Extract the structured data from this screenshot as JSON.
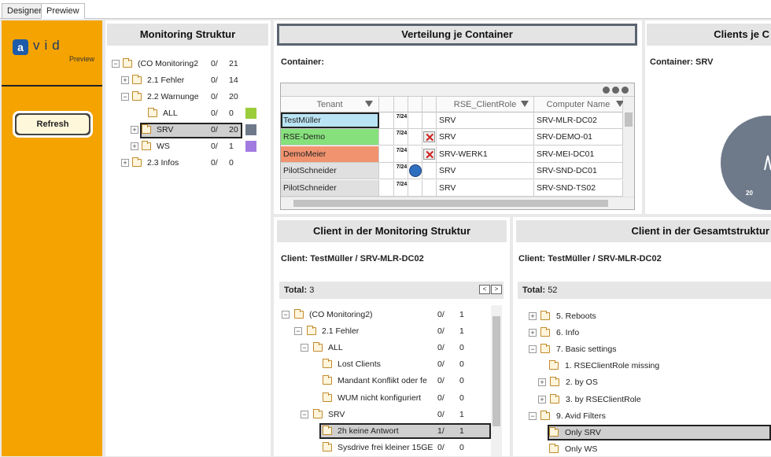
{
  "tabs": [
    "Designer",
    "Prewiew"
  ],
  "logo": {
    "mark": "a",
    "text": "vid",
    "sub": "Preview"
  },
  "refresh_label": "Refresh",
  "monitoring": {
    "title": "Monitoring Struktur",
    "rows": [
      {
        "pm": "−",
        "label": "(CO Monitoring2",
        "a": "0/",
        "b": "21"
      },
      {
        "pm": "+",
        "label": "2.1 Fehler",
        "a": "0/",
        "b": "14"
      },
      {
        "pm": "−",
        "label": "2.2 Warnunge",
        "a": "0/",
        "b": "20"
      },
      {
        "pm": "",
        "label": "ALL",
        "a": "0/",
        "b": "0"
      },
      {
        "pm": "+",
        "label": "SRV",
        "a": "0/",
        "b": "20"
      },
      {
        "pm": "+",
        "label": "WS",
        "a": "0/",
        "b": "1"
      },
      {
        "pm": "+",
        "label": "2.3 Infos",
        "a": "0/",
        "b": "0"
      }
    ],
    "swatch_colors": [
      "#9bcc3a",
      "#6e7a8a",
      "#a27be0"
    ]
  },
  "verteilung": {
    "title": "Verteilung je Container",
    "subtitle": "Container:",
    "columns": [
      "Tenant",
      "RSE_ClientRole",
      "Computer Name"
    ],
    "rows": [
      {
        "tenant": "TestMüller",
        "icon724": "7/24",
        "x": false,
        "globe": false,
        "role": "SRV",
        "computer": "SRV-MLR-DC02",
        "bg": "#b9e4f4"
      },
      {
        "tenant": "RSE-Demo",
        "icon724": "7/24",
        "x": true,
        "globe": false,
        "role": "SRV",
        "computer": "SRV-DEMO-01",
        "bg": "#86e07c"
      },
      {
        "tenant": "DemoMeier",
        "icon724": "7/24",
        "x": true,
        "globe": false,
        "role": "SRV-WERK1",
        "computer": "SRV-MEI-DC01",
        "bg": "#f1936f"
      },
      {
        "tenant": "PilotSchneider",
        "icon724": "7/24",
        "x": false,
        "globe": true,
        "role": "SRV",
        "computer": "SRV-SND-DC01",
        "bg": "#e0e0e0"
      },
      {
        "tenant": "PilotSchneider",
        "icon724": "7/24",
        "x": false,
        "globe": false,
        "role": "SRV",
        "computer": "SRV-SND-TS02",
        "bg": "#e0e0e0"
      }
    ]
  },
  "clients_je": {
    "title": "Clients je C",
    "subtitle": "Container: SRV",
    "pie_label": "20",
    "pie_color": "#6e7a8a"
  },
  "client_mon": {
    "title": "Client in der Monitoring Struktur",
    "client": "Client: TestMüller / SRV-MLR-DC02",
    "total_label": "Total:",
    "total_value": "3",
    "nav_prev": "<",
    "nav_next": ">",
    "rows": [
      {
        "pm": "−",
        "label": "(CO Monitoring2)",
        "a": "0/",
        "b": "1"
      },
      {
        "pm": "−",
        "label": "2.1 Fehler",
        "a": "0/",
        "b": "1"
      },
      {
        "pm": "−",
        "label": "ALL",
        "a": "0/",
        "b": "0"
      },
      {
        "pm": "",
        "label": "Lost Clients",
        "a": "0/",
        "b": "0"
      },
      {
        "pm": "",
        "label": "Mandant Konflikt oder fe",
        "a": "0/",
        "b": "0"
      },
      {
        "pm": "",
        "label": "WUM nicht konfiguriert",
        "a": "0/",
        "b": "0"
      },
      {
        "pm": "−",
        "label": "SRV",
        "a": "0/",
        "b": "1"
      },
      {
        "pm": "",
        "label": "2h keine Antwort",
        "a": "1/",
        "b": "1"
      },
      {
        "pm": "",
        "label": "Sysdrive frei kleiner 15GE",
        "a": "0/",
        "b": "0"
      }
    ]
  },
  "client_ges": {
    "title": "Client in der Gesamtstruktur",
    "client": "Client: TestMüller / SRV-MLR-DC02",
    "total_label": "Total:",
    "total_value": "52",
    "rows": [
      {
        "pm": "+",
        "label": "5. Reboots"
      },
      {
        "pm": "+",
        "label": "6. Info"
      },
      {
        "pm": "−",
        "label": "7. Basic settings"
      },
      {
        "pm": "",
        "label": "1. RSEClientRole missing"
      },
      {
        "pm": "+",
        "label": "2. by OS"
      },
      {
        "pm": "+",
        "label": "3. by RSEClientRole"
      },
      {
        "pm": "−",
        "label": "9. Avid Filters"
      },
      {
        "pm": "",
        "label": "Only SRV"
      },
      {
        "pm": "",
        "label": "Only WS"
      }
    ]
  }
}
